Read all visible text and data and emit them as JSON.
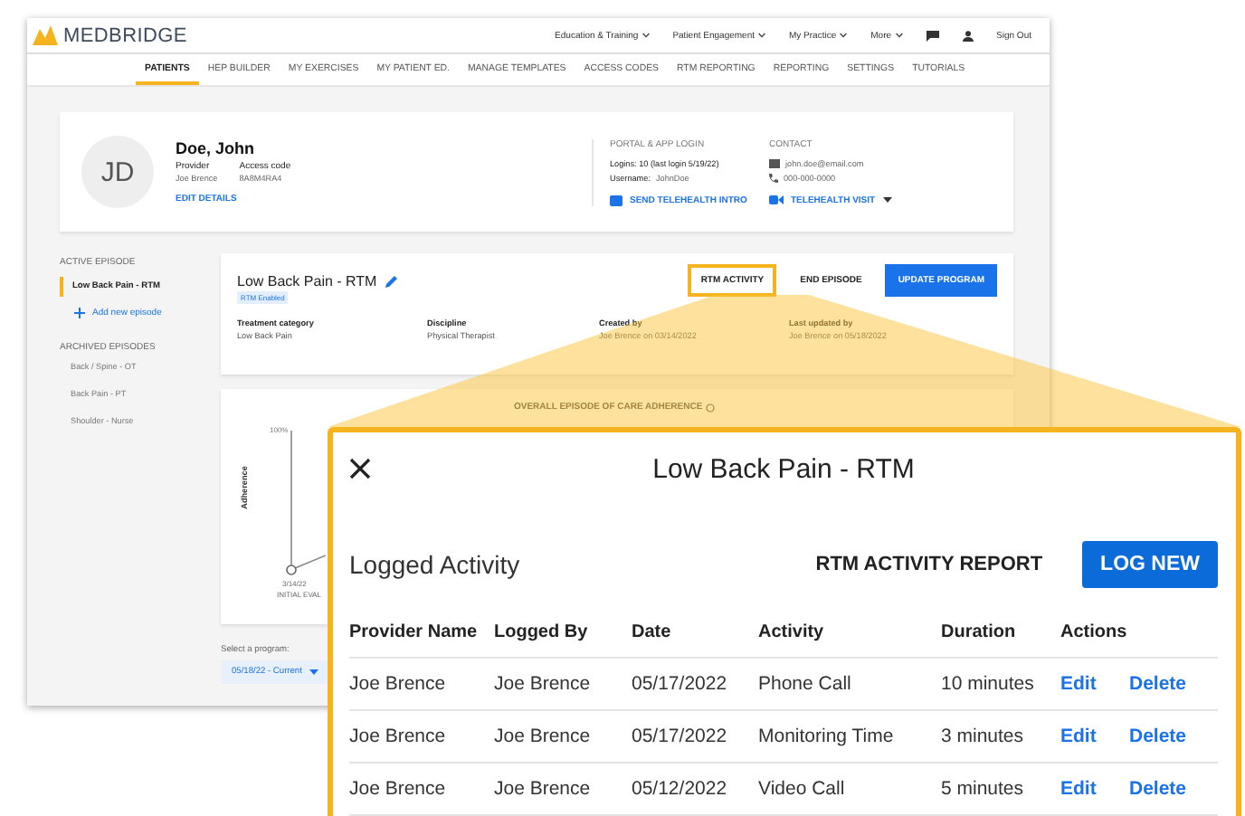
{
  "app": {
    "logo": "MEDBRIDGE",
    "top_menu": [
      {
        "kind": "dropdown",
        "label": "Education & Training"
      },
      {
        "kind": "dropdown",
        "label": "Patient Engagement"
      },
      {
        "kind": "dropdown",
        "label": "My Practice"
      },
      {
        "kind": "dropdown",
        "label": "More"
      },
      {
        "kind": "chat"
      },
      {
        "kind": "user"
      },
      {
        "kind": "link",
        "label": "Sign Out"
      }
    ],
    "tabs": [
      {
        "label": "PATIENTS",
        "selected": true
      },
      {
        "label": "HEP BUILDER",
        "selected": false
      },
      {
        "label": "MY EXERCISES",
        "selected": false
      },
      {
        "label": "MY PATIENT ED.",
        "selected": false
      },
      {
        "label": "MANAGE TEMPLATES",
        "selected": false
      },
      {
        "label": "ACCESS CODES",
        "selected": false
      },
      {
        "label": "RTM REPORTING",
        "selected": false
      },
      {
        "label": "REPORTING",
        "selected": false
      },
      {
        "label": "SETTINGS",
        "selected": false
      },
      {
        "label": "TUTORIALS",
        "selected": false
      }
    ],
    "patient": {
      "initials": "JD",
      "name": "Doe, John",
      "fields": [
        {
          "label": "Provider",
          "value": "Joe Brence"
        },
        {
          "label": "Access code",
          "value": "8A8M4RA4"
        }
      ],
      "edit_link": "EDIT DETAILS",
      "portal": {
        "heading": "PORTAL & APP LOGIN",
        "logins": "Logins: 10 (last login 5/19/22)",
        "username_label": "Username:",
        "username": "JohnDoe",
        "action": "SEND TELEHEALTH INTRO"
      },
      "contact": {
        "heading": "CONTACT",
        "email": "john.doe@email.com",
        "phone": "000-000-0000",
        "action": "TELEHEALTH VISIT"
      }
    },
    "sidebar": {
      "active_heading": "ACTIVE EPISODE",
      "active": [
        {
          "label": "Low Back Pain - RTM",
          "selected": true
        }
      ],
      "add": "Add new episode",
      "archived_heading": "ARCHIVED EPISODES",
      "archived": [
        "Back / Spine - OT",
        "Back Pain - PT",
        "Shoulder - Nurse"
      ]
    },
    "episode": {
      "title": "Low Back Pain - RTM",
      "badge": "RTM Enabled",
      "buttons": [
        {
          "kind": "highlighted",
          "label": "RTM ACTIVITY"
        },
        {
          "kind": "text",
          "label": "END EPISODE"
        },
        {
          "kind": "primary",
          "label": "UPDATE PROGRAM"
        }
      ],
      "details": [
        {
          "label": "Treatment category",
          "value": "Low Back Pain"
        },
        {
          "label": "Discipline",
          "value": "Physical Therapist"
        },
        {
          "label": "Created by",
          "value": "Joe Brence on 03/14/2022"
        },
        {
          "label": "Last updated by",
          "value": "Joe Brence on 05/18/2022"
        }
      ]
    },
    "adherence": {
      "title": "OVERALL EPISODE OF CARE ADHERENCE",
      "y_tick": "100%",
      "y_label": "Adherence",
      "point_date": "3/14/22",
      "point_label": "INITIAL EVAL"
    },
    "program_select": {
      "label": "Select a program:",
      "value": "05/18/22 - Current"
    }
  },
  "modal": {
    "title": "Low Back Pain - RTM",
    "section": "Logged Activity",
    "report_link": "RTM ACTIVITY REPORT",
    "primary_button": "LOG NEW",
    "columns": [
      "Provider Name",
      "Logged By",
      "Date",
      "Activity",
      "Duration",
      "Actions"
    ],
    "rows": [
      {
        "cells": [
          "Joe Brence",
          "Joe Brence",
          "05/17/2022",
          "Phone Call",
          "10 minutes"
        ],
        "actions": [
          "Edit",
          "Delete"
        ]
      },
      {
        "cells": [
          "Joe Brence",
          "Joe Brence",
          "05/17/2022",
          "Monitoring Time",
          "3 minutes"
        ],
        "actions": [
          "Edit",
          "Delete"
        ]
      },
      {
        "cells": [
          "Joe Brence",
          "Joe Brence",
          "05/12/2022",
          "Video Call",
          "5 minutes"
        ],
        "actions": [
          "Edit",
          "Delete"
        ]
      }
    ]
  }
}
